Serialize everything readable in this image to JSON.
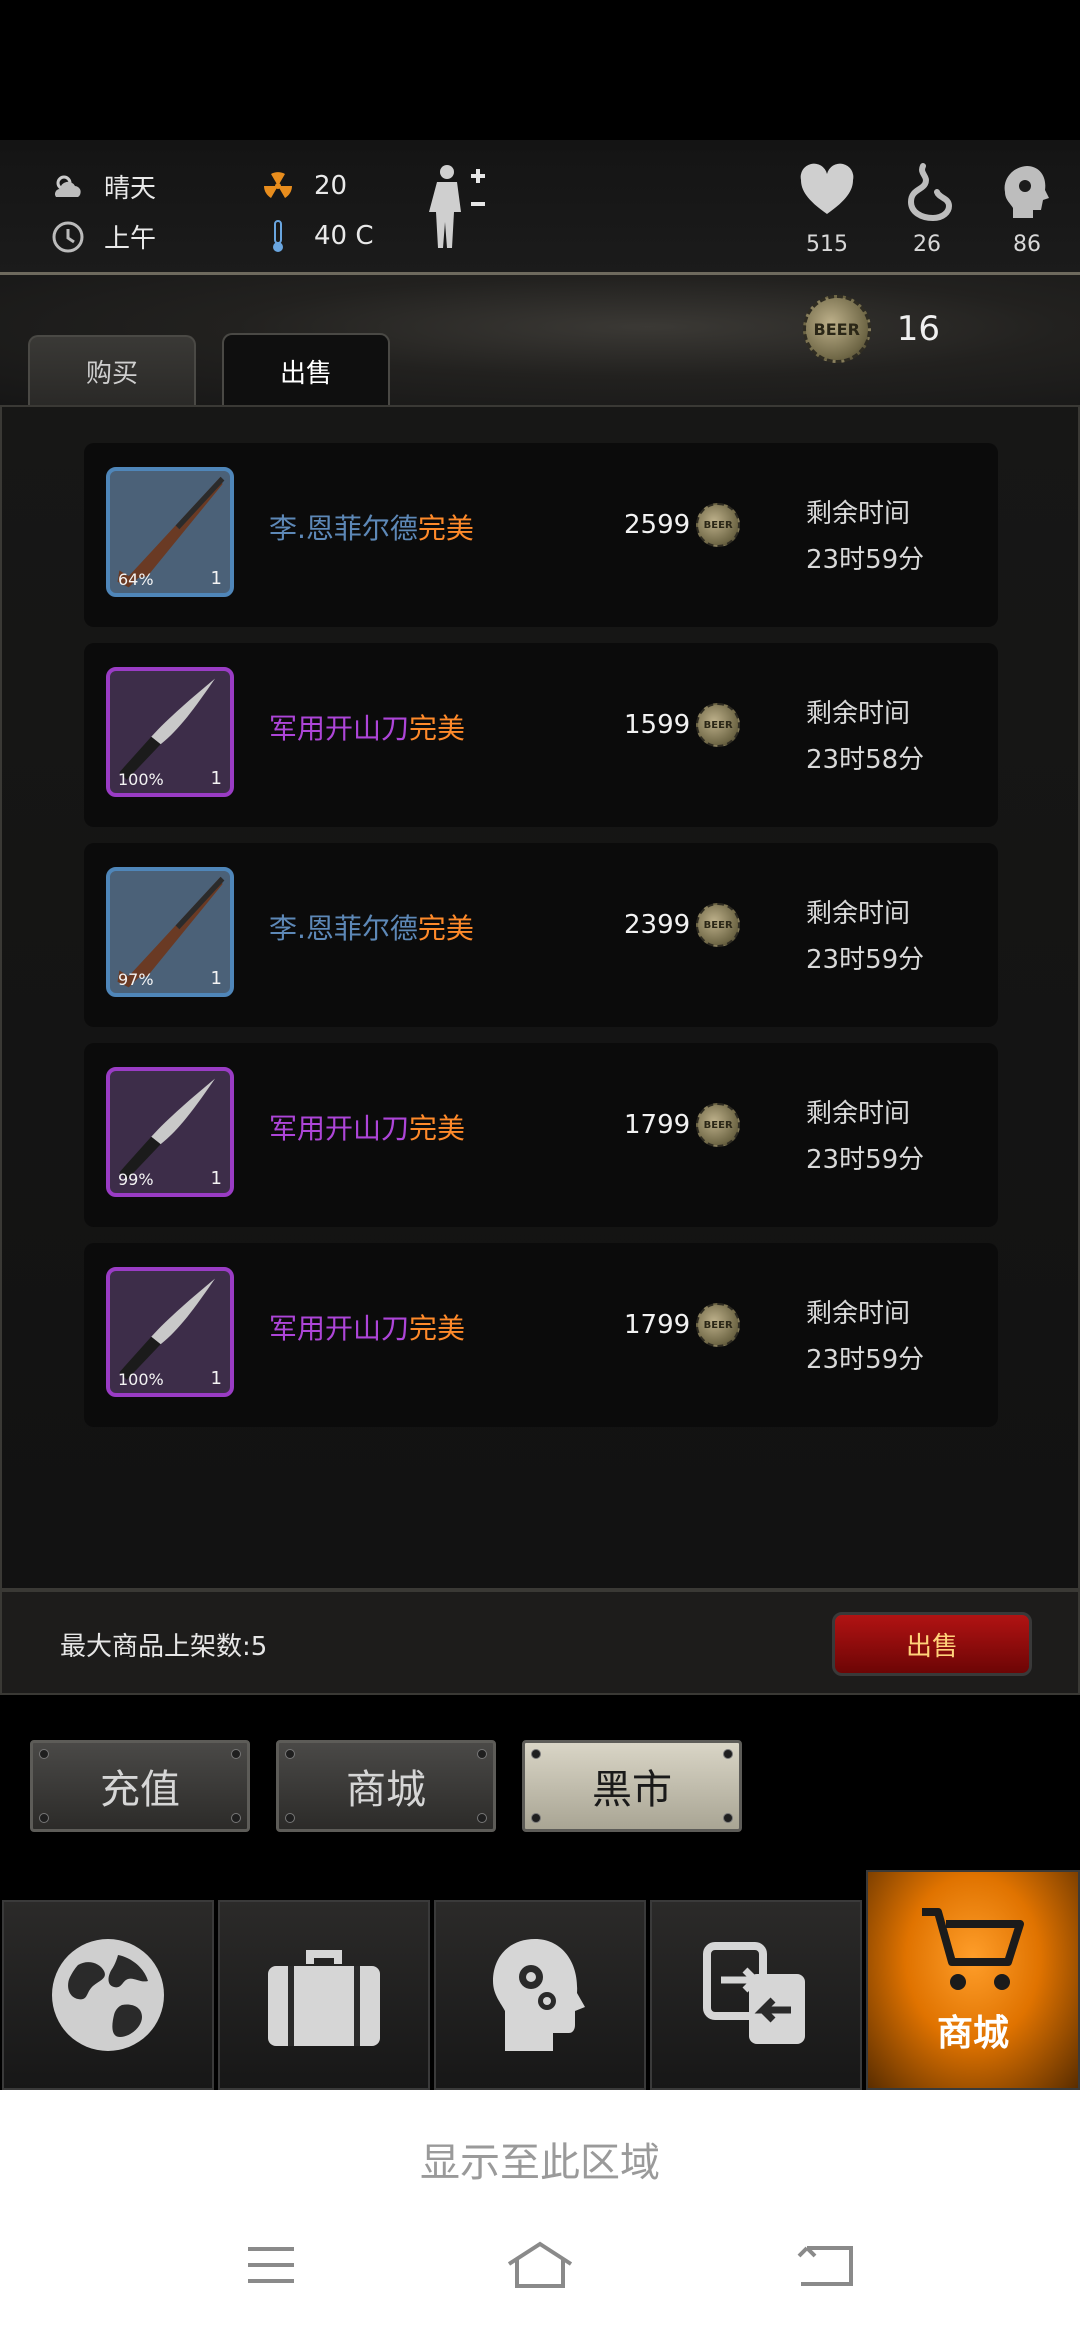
{
  "hud": {
    "weather": "晴天",
    "time_of_day": "上午",
    "radiation": "20",
    "temperature": "40 C",
    "health": "515",
    "hunger": "26",
    "mind": "86"
  },
  "market": {
    "balance": "16",
    "tabs": [
      "购买",
      "出售"
    ],
    "coin_icon_text": "BEER"
  },
  "listings": [
    {
      "name": "李.恩菲尔德",
      "quality": "完美",
      "rarity": "blue",
      "durability": "64%",
      "qty": "1",
      "price": "2599",
      "time_label": "剩余时间",
      "time": "23时59分",
      "item": "rifle"
    },
    {
      "name": "军用开山刀",
      "quality": "完美",
      "rarity": "purple",
      "durability": "100%",
      "qty": "1",
      "price": "1599",
      "time_label": "剩余时间",
      "time": "23时58分",
      "item": "machete"
    },
    {
      "name": "李.恩菲尔德",
      "quality": "完美",
      "rarity": "blue",
      "durability": "97%",
      "qty": "1",
      "price": "2399",
      "time_label": "剩余时间",
      "time": "23时59分",
      "item": "rifle"
    },
    {
      "name": "军用开山刀",
      "quality": "完美",
      "rarity": "purple",
      "durability": "99%",
      "qty": "1",
      "price": "1799",
      "time_label": "剩余时间",
      "time": "23时59分",
      "item": "machete"
    },
    {
      "name": "军用开山刀",
      "quality": "完美",
      "rarity": "purple",
      "durability": "100%",
      "qty": "1",
      "price": "1799",
      "time_label": "剩余时间",
      "time": "23时59分",
      "item": "machete"
    }
  ],
  "footer": {
    "max_listings_label": "最大商品上架数:5",
    "sell_button": "出售"
  },
  "plates": [
    "充值",
    "商城",
    "黑市"
  ],
  "nav": {
    "items": [
      "globe-icon",
      "suitcase-icon",
      "head-gears-icon",
      "exchange-icon",
      "cart-icon"
    ],
    "active_label": "商城"
  },
  "system": {
    "hint": "显示至此区域"
  }
}
